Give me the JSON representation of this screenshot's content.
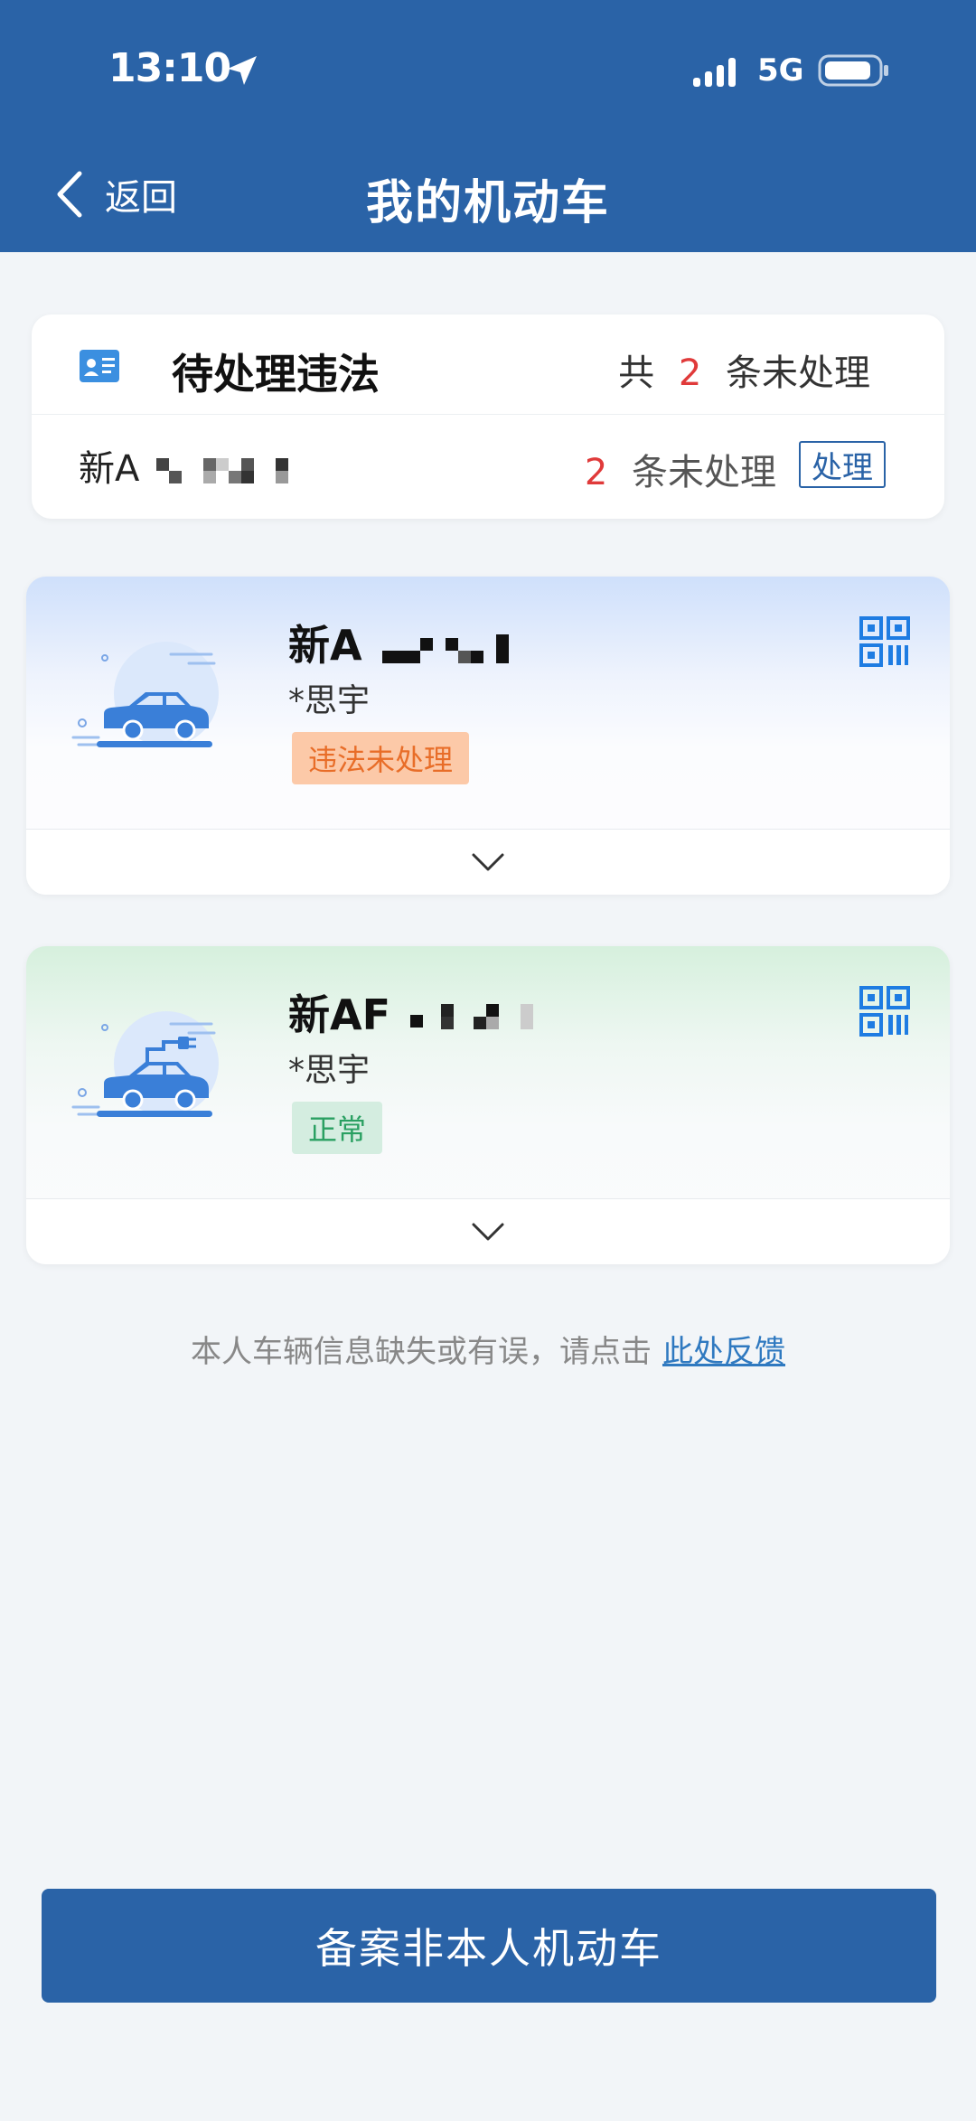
{
  "status_bar": {
    "time": "13:10",
    "network": "5G"
  },
  "header": {
    "back_label": "返回",
    "title": "我的机动车"
  },
  "pending": {
    "title": "待处理违法",
    "total_prefix": "共",
    "total_count": "2",
    "total_suffix": "条未处理",
    "plate": "新A",
    "count": "2",
    "count_suffix": "条未处理",
    "action_label": "处理"
  },
  "vehicles": [
    {
      "plate": "新A",
      "owner": "*思宇",
      "status": "违法未处理"
    },
    {
      "plate": "新AF",
      "owner": "*思宇",
      "status": "正常"
    }
  ],
  "feedback": {
    "text": "本人车辆信息缺失或有误，请点击",
    "link": "此处反馈"
  },
  "bottom_button": "备案非本人机动车",
  "colors": {
    "primary": "#2a63a7",
    "warn": "#e86d28",
    "ok": "#2aa062",
    "alert": "#e03a3a"
  }
}
